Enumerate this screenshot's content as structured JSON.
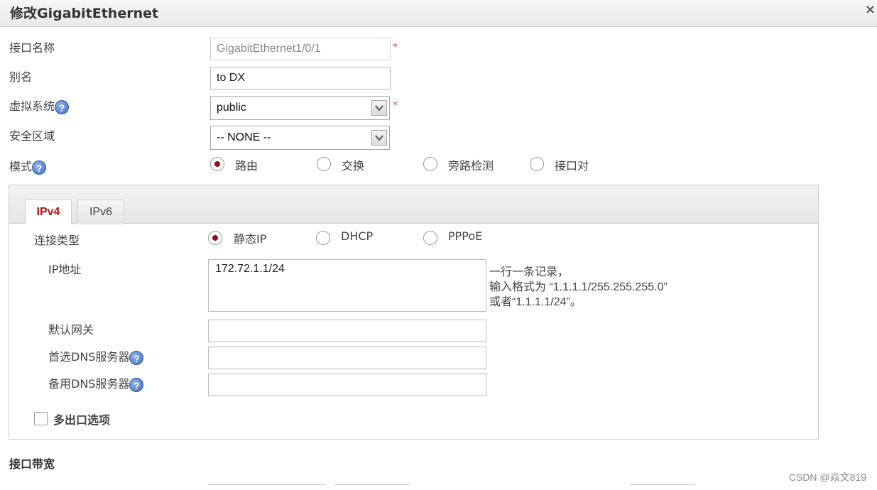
{
  "dialog": {
    "title": "修改GigabitEthernet",
    "close_symbol": "×"
  },
  "form": {
    "interface_name": {
      "label": "接口名称",
      "value": "GigabitEthernet1/0/1",
      "required": "*"
    },
    "alias": {
      "label": "别名",
      "value": "to DX"
    },
    "vsys": {
      "label": "虚拟系统",
      "value": "public",
      "required": "*"
    },
    "security_zone": {
      "label": "安全区域",
      "value": "-- NONE --"
    },
    "mode": {
      "label": "模式",
      "options": [
        "路由",
        "交换",
        "旁路检测",
        "接口对"
      ],
      "selected": "路由"
    }
  },
  "tabs": [
    {
      "label": "IPv4",
      "active": true
    },
    {
      "label": "IPv6",
      "active": false
    }
  ],
  "ipv4": {
    "connection_type": {
      "label": "连接类型",
      "options": [
        "静态IP",
        "DHCP",
        "PPPoE"
      ],
      "selected": "静态IP"
    },
    "ip_address": {
      "label": "IP地址",
      "value": "172.72.1.1/24",
      "hint_line1": "一行一条记录，",
      "hint_line2": "输入格式为 “1.1.1.1/255.255.255.0”",
      "hint_line3": "或者“1.1.1.1/24”。"
    },
    "default_gateway": {
      "label": "默认网关",
      "value": ""
    },
    "primary_dns": {
      "label": "首选DNS服务器",
      "value": ""
    },
    "secondary_dns": {
      "label": "备用DNS服务器",
      "value": ""
    },
    "multi_egress": {
      "label": "多出口选项",
      "checked": false
    }
  },
  "bandwidth": {
    "label": "接口带宽"
  },
  "help_symbol": "?",
  "watermark": "CSDN @焱文819",
  "colors": {
    "tab_active_text": "#b11414",
    "radio_selected": "#8e1014",
    "required": "#e0483a",
    "help_icon": "#3c6fc6"
  }
}
